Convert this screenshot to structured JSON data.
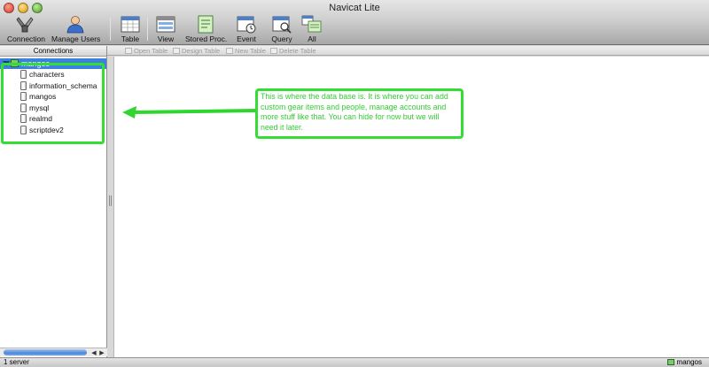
{
  "window": {
    "title": "Navicat Lite"
  },
  "toolbar": {
    "connection": "Connection",
    "manage_users": "Manage Users",
    "table": "Table",
    "view": "View",
    "stored_proc": "Stored Proc.",
    "event": "Event",
    "query": "Query",
    "all": "All"
  },
  "sidebar": {
    "header": "Connections",
    "root": "mangos",
    "items": [
      {
        "label": "characters"
      },
      {
        "label": "information_schema"
      },
      {
        "label": "mangos"
      },
      {
        "label": "mysql"
      },
      {
        "label": "realmd"
      },
      {
        "label": "scriptdev2"
      }
    ]
  },
  "subtoolbar": {
    "open_table": "Open Table",
    "design_table": "Design Table",
    "new_table": "New Table",
    "delete_table": "Delete Table"
  },
  "annotation": {
    "text": "This is where the data base is.  It is where you can add custom gear items and people, manage accounts and more stuff like that.  You can hide for now but we will need it later."
  },
  "statusbar": {
    "left": "1 server",
    "right": "mangos"
  },
  "colors": {
    "highlight": "#33dd33",
    "selection": "#3d80df"
  }
}
